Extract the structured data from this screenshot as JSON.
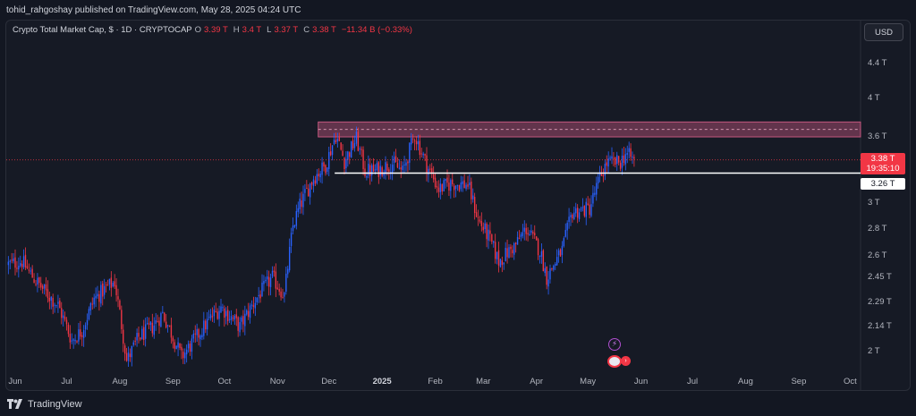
{
  "header": {
    "publisher_line": "tohid_rahgoshay published on TradingView.com, May 28, 2025 04:24 UTC"
  },
  "legend": {
    "symbol": "Crypto Total Market Cap, $ · 1D · CRYPTOCAP",
    "open_label": "O",
    "open": "3.39 T",
    "high_label": "H",
    "high": "3.4 T",
    "low_label": "L",
    "low": "3.37 T",
    "close_label": "C",
    "close": "3.38 T",
    "change": "−11.34 B (−0.33%)"
  },
  "currency": "USD",
  "price_badge": {
    "price": "3.38 T",
    "countdown": "19:35:10"
  },
  "level_badge": "3.26 T",
  "footer": {
    "brand": "TradingView"
  },
  "colors": {
    "up": "#2962ff",
    "down": "#f23645",
    "zone": "#a34a6e",
    "background": "#161a25"
  },
  "chart_data": {
    "type": "candlestick",
    "title": "Crypto Total Market Cap, $ · 1D · CRYPTOCAP",
    "unit": "T",
    "scale": "log",
    "y_ticks": [
      "4.4 T",
      "4 T",
      "3.6 T",
      "3 T",
      "2.8 T",
      "2.6 T",
      "2.45 T",
      "2.29 T",
      "2.14 T",
      "2 T"
    ],
    "y_tick_values": [
      4.4,
      4.0,
      3.6,
      3.0,
      2.8,
      2.6,
      2.45,
      2.29,
      2.14,
      2.0
    ],
    "x_ticks": [
      "Jun",
      "Jul",
      "Aug",
      "Sep",
      "Oct",
      "Nov",
      "Dec",
      "2025",
      "Feb",
      "Mar",
      "Apr",
      "May",
      "Jun",
      "Jul",
      "Aug",
      "Sep",
      "Oct"
    ],
    "x_tick_dates": [
      "2024-06-01",
      "2024-07-01",
      "2024-08-01",
      "2024-09-01",
      "2024-10-01",
      "2024-11-01",
      "2024-12-01",
      "2025-01-01",
      "2025-02-01",
      "2025-03-01",
      "2025-04-01",
      "2025-05-01",
      "2025-06-01",
      "2025-07-01",
      "2025-08-01",
      "2025-09-01",
      "2025-10-01"
    ],
    "series": [
      {
        "points": [
          [
            "2024-05-28",
            2.54
          ],
          [
            "2024-06-05",
            2.56
          ],
          [
            "2024-06-12",
            2.44
          ],
          [
            "2024-06-19",
            2.35
          ],
          [
            "2024-06-26",
            2.27
          ],
          [
            "2024-07-04",
            2.06
          ],
          [
            "2024-07-10",
            2.12
          ],
          [
            "2024-07-17",
            2.31
          ],
          [
            "2024-07-24",
            2.38
          ],
          [
            "2024-07-29",
            2.42
          ],
          [
            "2024-08-05",
            1.95
          ],
          [
            "2024-08-12",
            2.08
          ],
          [
            "2024-08-20",
            2.14
          ],
          [
            "2024-08-26",
            2.22
          ],
          [
            "2024-09-06",
            1.97
          ],
          [
            "2024-09-14",
            2.07
          ],
          [
            "2024-09-22",
            2.18
          ],
          [
            "2024-09-29",
            2.26
          ],
          [
            "2024-10-10",
            2.14
          ],
          [
            "2024-10-20",
            2.32
          ],
          [
            "2024-10-29",
            2.45
          ],
          [
            "2024-11-05",
            2.33
          ],
          [
            "2024-11-10",
            2.82
          ],
          [
            "2024-11-14",
            2.98
          ],
          [
            "2024-11-22",
            3.22
          ],
          [
            "2024-11-29",
            3.33
          ],
          [
            "2024-12-05",
            3.62
          ],
          [
            "2024-12-10",
            3.37
          ],
          [
            "2024-12-17",
            3.58
          ],
          [
            "2024-12-22",
            3.28
          ],
          [
            "2024-12-28",
            3.28
          ],
          [
            "2025-01-07",
            3.35
          ],
          [
            "2025-01-13",
            3.27
          ],
          [
            "2025-01-20",
            3.62
          ],
          [
            "2025-01-27",
            3.33
          ],
          [
            "2025-02-03",
            3.12
          ],
          [
            "2025-02-10",
            3.17
          ],
          [
            "2025-02-20",
            3.16
          ],
          [
            "2025-02-26",
            2.87
          ],
          [
            "2025-03-04",
            2.74
          ],
          [
            "2025-03-10",
            2.56
          ],
          [
            "2025-03-20",
            2.68
          ],
          [
            "2025-03-26",
            2.8
          ],
          [
            "2025-04-03",
            2.64
          ],
          [
            "2025-04-07",
            2.45
          ],
          [
            "2025-04-16",
            2.64
          ],
          [
            "2025-04-22",
            2.93
          ],
          [
            "2025-05-02",
            2.96
          ],
          [
            "2025-05-08",
            3.22
          ],
          [
            "2025-05-12",
            3.35
          ],
          [
            "2025-05-20",
            3.36
          ],
          [
            "2025-05-23",
            3.44
          ],
          [
            "2025-05-28",
            3.38
          ]
        ]
      }
    ],
    "annotations": [
      {
        "type": "zone",
        "from": "2024-12-01",
        "to": "2025-10-01",
        "y_low": 3.6,
        "y_high": 3.75
      },
      {
        "type": "horizontal_line",
        "value": 3.26,
        "from": "2024-12-20",
        "label": "3.26 T"
      },
      {
        "type": "price_line",
        "value": 3.38,
        "label": "3.38 T"
      }
    ]
  }
}
